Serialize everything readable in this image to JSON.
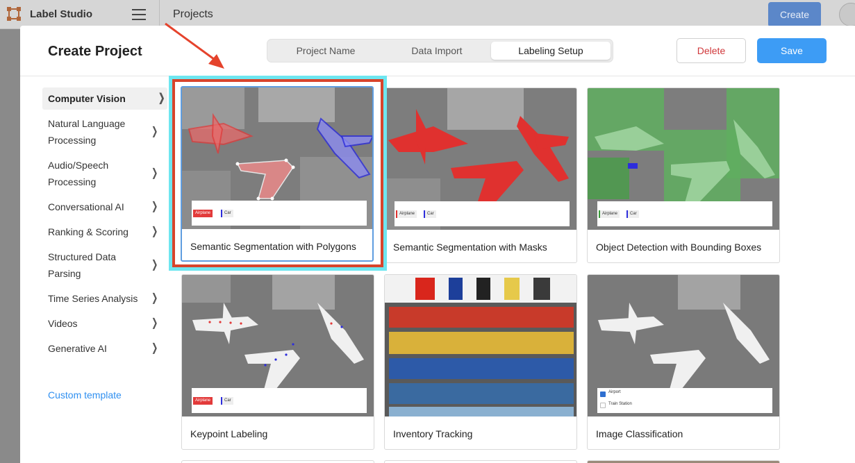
{
  "app": {
    "name": "Label Studio",
    "breadcrumb": "Projects",
    "create_label": "Create"
  },
  "modal": {
    "title": "Create Project",
    "steps": [
      "Project Name",
      "Data Import",
      "Labeling Setup"
    ],
    "active_step": "Labeling Setup",
    "delete_label": "Delete",
    "save_label": "Save"
  },
  "sidebar": {
    "items": [
      {
        "label": "Computer Vision",
        "active": true
      },
      {
        "label": "Natural Language Processing"
      },
      {
        "label": "Audio/Speech Processing"
      },
      {
        "label": "Conversational AI"
      },
      {
        "label": "Ranking & Scoring"
      },
      {
        "label": "Structured Data Parsing"
      },
      {
        "label": "Time Series Analysis"
      },
      {
        "label": "Videos"
      },
      {
        "label": "Generative AI"
      }
    ],
    "custom_template": "Custom template"
  },
  "templates": [
    {
      "title": "Semantic Segmentation with Polygons",
      "selected": true,
      "chips": [
        "Airplane",
        "Car"
      ]
    },
    {
      "title": "Semantic Segmentation with Masks",
      "chips": [
        "Airplane",
        "Car"
      ]
    },
    {
      "title": "Object Detection with Bounding Boxes",
      "chips": [
        "Airplane",
        "Car"
      ]
    },
    {
      "title": "Keypoint Labeling",
      "chips": [
        "Airplane",
        "Car"
      ]
    },
    {
      "title": "Inventory Tracking"
    },
    {
      "title": "Image Classification",
      "choices": [
        "Airport",
        "Train Station"
      ]
    }
  ],
  "colors": {
    "accent": "#3d9cf5",
    "danger": "#d0383b",
    "highlight_cyan": "#6ee6f0",
    "highlight_red": "#d8442c"
  }
}
